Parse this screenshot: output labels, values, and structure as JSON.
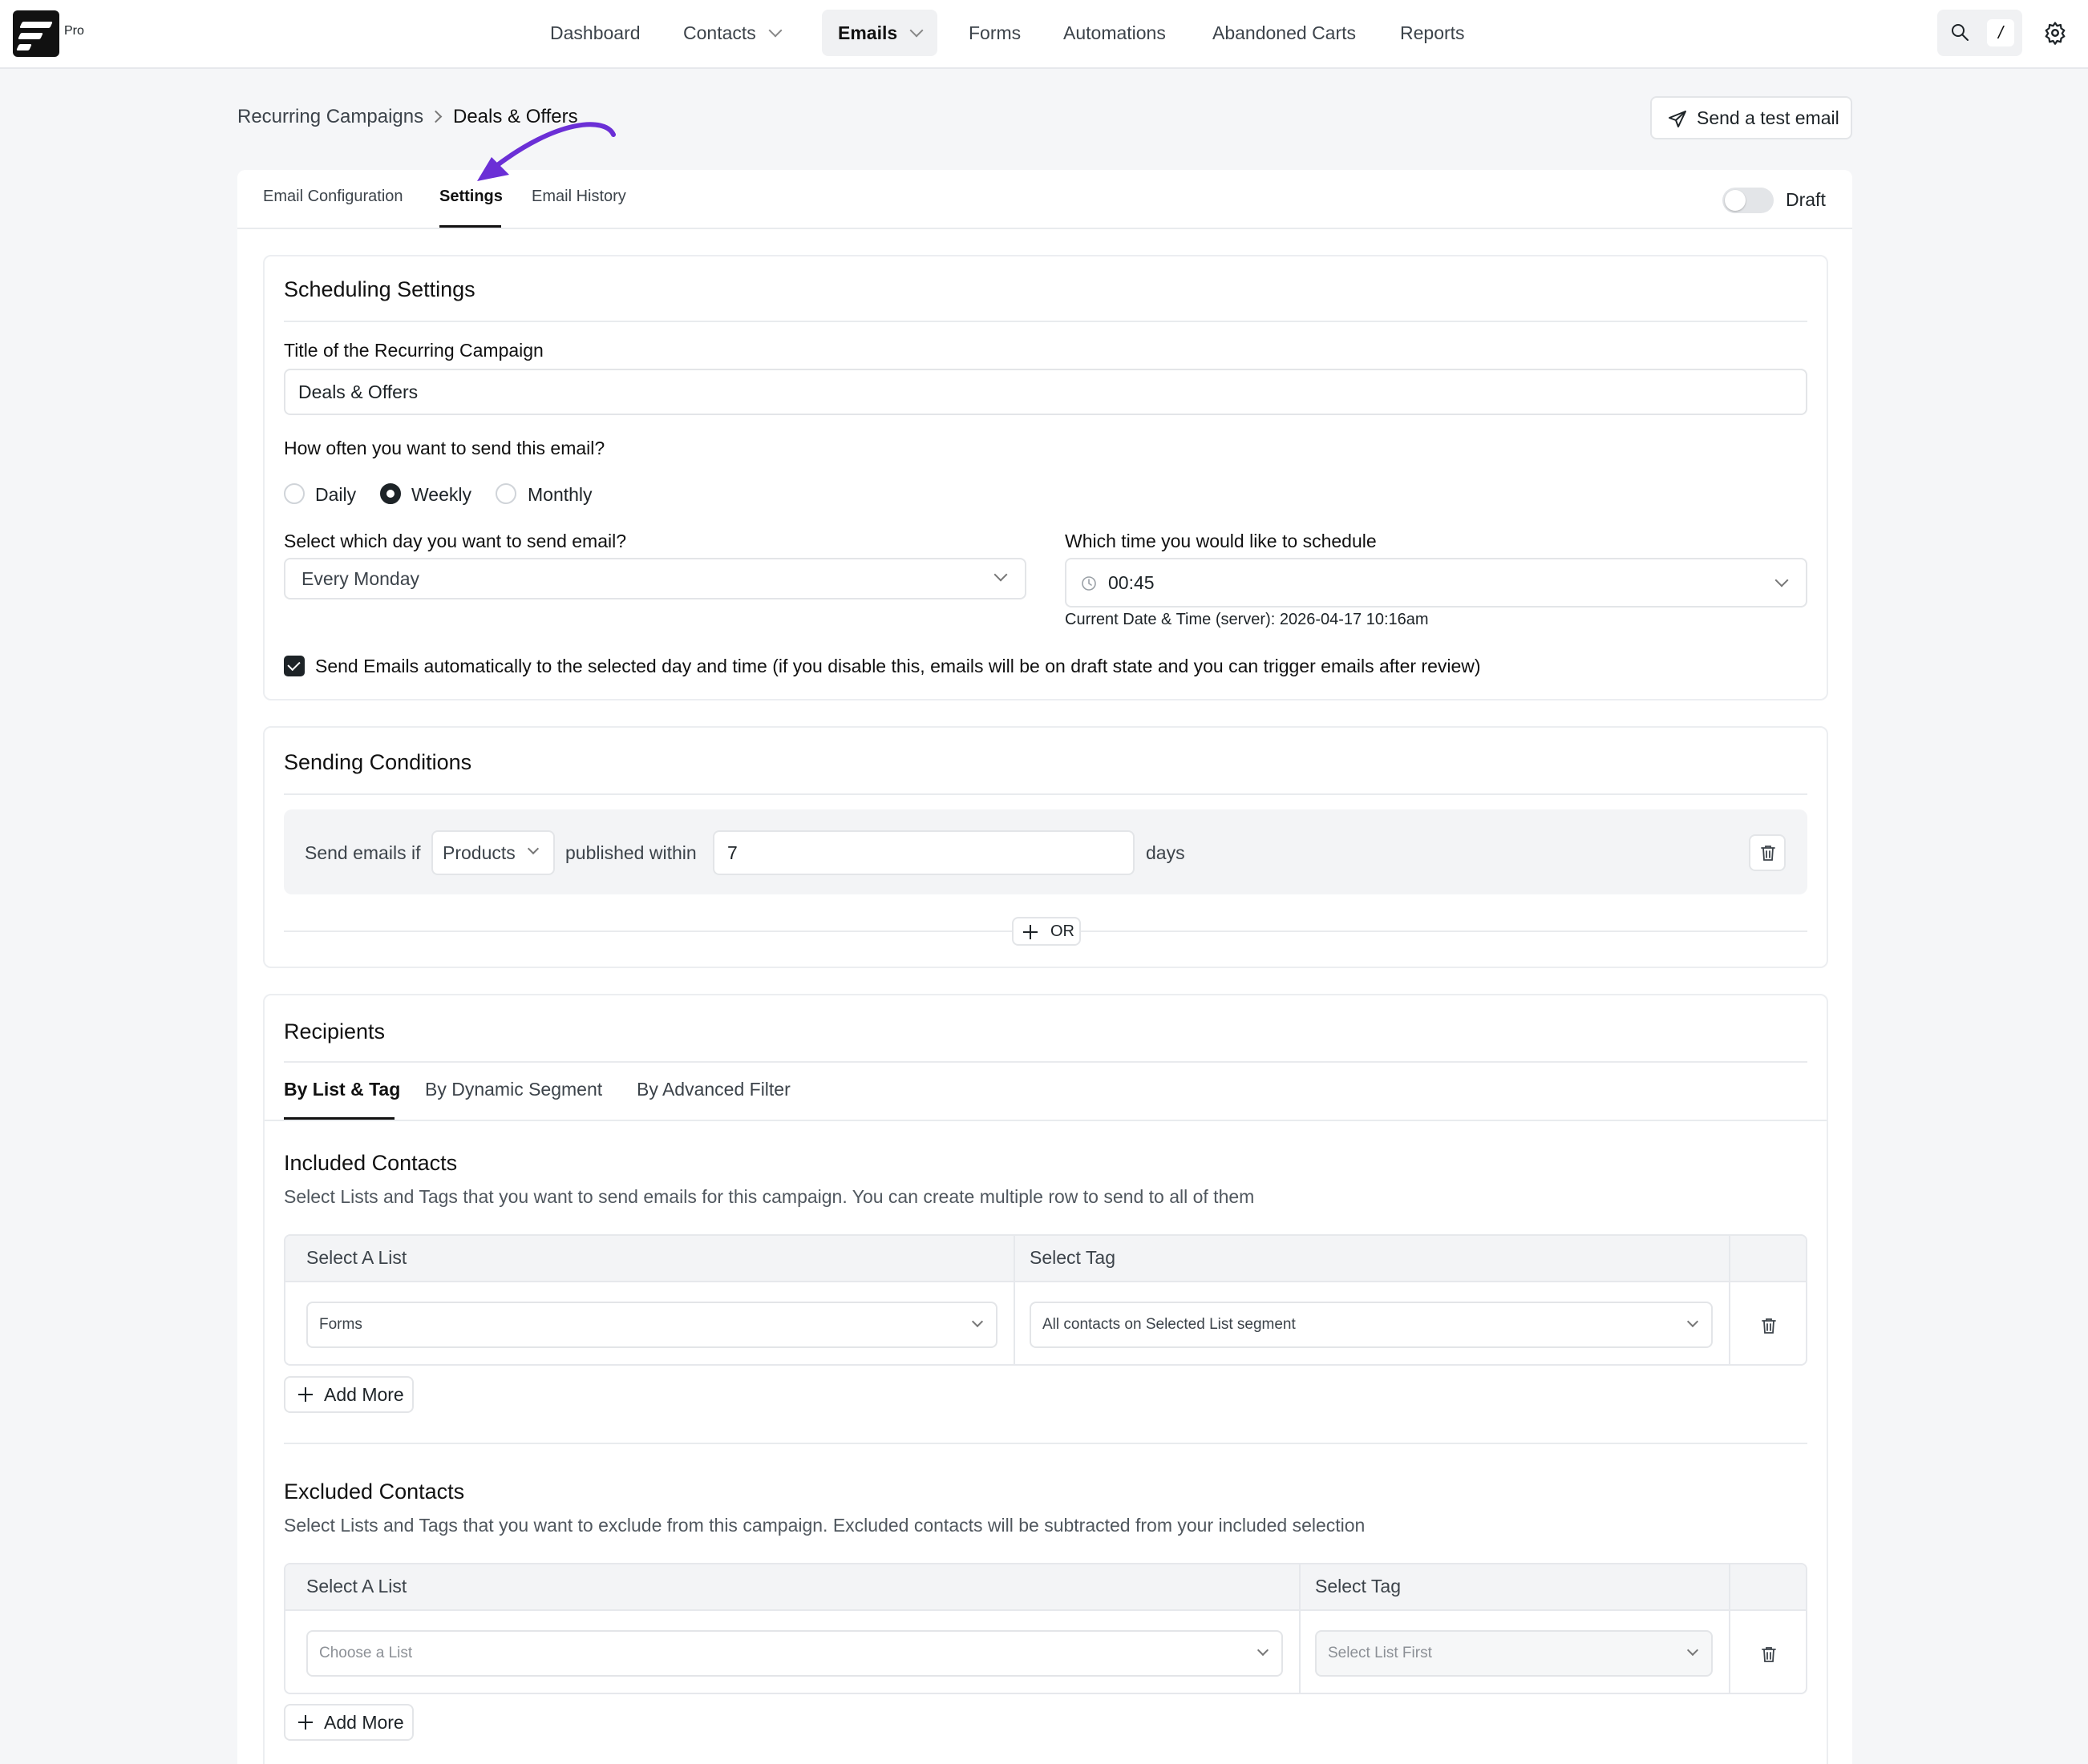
{
  "app": {
    "brand_tag": "Pro"
  },
  "nav": {
    "items": [
      {
        "label": "Dashboard"
      },
      {
        "label": "Contacts"
      },
      {
        "label": "Emails"
      },
      {
        "label": "Forms"
      },
      {
        "label": "Automations"
      },
      {
        "label": "Abandoned Carts"
      },
      {
        "label": "Reports"
      }
    ],
    "shortcut_key": "/"
  },
  "breadcrumb": {
    "parent": "Recurring Campaigns",
    "current": "Deals & Offers"
  },
  "actions": {
    "send_test": "Send a test email"
  },
  "tabs": [
    {
      "label": "Email Configuration"
    },
    {
      "label": "Settings"
    },
    {
      "label": "Email History"
    }
  ],
  "status": {
    "label": "Draft",
    "enabled": false
  },
  "scheduling": {
    "title": "Scheduling Settings",
    "campaign_title_label": "Title of the Recurring Campaign",
    "campaign_title_value": "Deals & Offers",
    "frequency_label": "How often you want to send this email?",
    "frequency_options": [
      "Daily",
      "Weekly",
      "Monthly"
    ],
    "frequency_selected": "Weekly",
    "day_label": "Select which day you want to send email?",
    "day_value": "Every Monday",
    "time_label": "Which time you would like to schedule",
    "time_value": "00:45",
    "server_time": "Current Date & Time (server): 2026-04-17 10:16am",
    "auto_send_label": "Send Emails automatically to the selected day and time (if you disable this, emails will be on draft state and you can trigger emails after review)",
    "auto_send_checked": true
  },
  "conditions": {
    "title": "Sending Conditions",
    "prefix": "Send emails if",
    "subject": "Products",
    "middle": "published within",
    "value": "7",
    "suffix": "days",
    "or_label": "OR"
  },
  "recipients": {
    "title": "Recipients",
    "tabs": [
      {
        "label": "By List & Tag"
      },
      {
        "label": "By Dynamic Segment"
      },
      {
        "label": "By Advanced Filter"
      }
    ],
    "included": {
      "title": "Included Contacts",
      "description": "Select Lists and Tags that you want to send emails for this campaign. You can create multiple row to send to all of them",
      "col_list": "Select A List",
      "col_tag": "Select Tag",
      "row_list": "Forms",
      "row_tag": "All contacts on Selected List segment",
      "add_more": "Add More"
    },
    "excluded": {
      "title": "Excluded Contacts",
      "description": "Select Lists and Tags that you want to exclude from this campaign. Excluded contacts will be subtracted from your included selection",
      "col_list": "Select A List",
      "col_tag": "Select Tag",
      "row_list": "Choose a List",
      "row_tag": "Select List First",
      "add_more": "Add More"
    }
  },
  "colors": {
    "accent_annotation": "#6b2fd6",
    "dark": "#1d2327"
  }
}
